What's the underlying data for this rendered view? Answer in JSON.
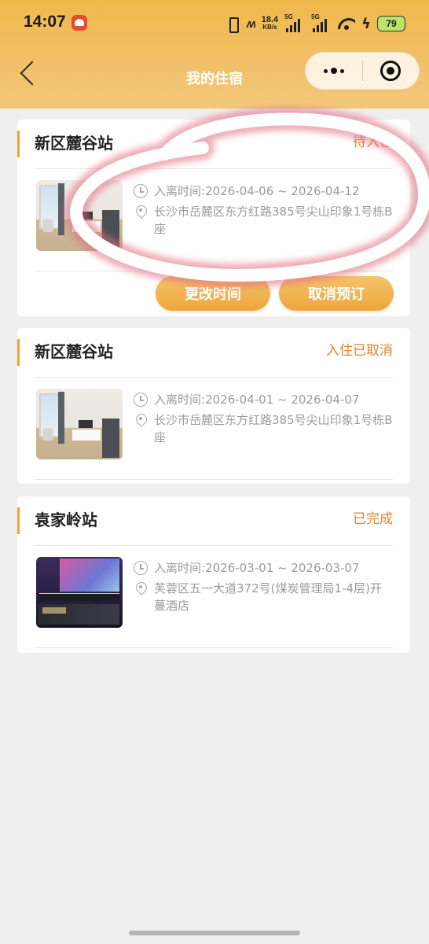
{
  "status_bar": {
    "time": "14:07",
    "network_speed": "18.4",
    "network_unit": "KB/s",
    "signal1_label": "5G",
    "signal2_label": "5G",
    "battery": "79"
  },
  "nav": {
    "title": "我的住宿"
  },
  "labels": {
    "time_prefix": "入离时间:"
  },
  "bookings": [
    {
      "station": "新区麓谷站",
      "status": "待入住",
      "dates": "2026-04-06 ~ 2026-04-12",
      "address": "长沙市岳麓区东方红路385号尖山印象1号栋B座",
      "actions": [
        "更改时间",
        "取消预订"
      ]
    },
    {
      "station": "新区麓谷站",
      "status": "入住已取消",
      "dates": "2026-04-01 ~ 2026-04-07",
      "address": "长沙市岳麓区东方红路385号尖山印象1号栋B座"
    },
    {
      "station": "袁家岭站",
      "status": "已完成",
      "dates": "2026-03-01 ~ 2026-03-07",
      "address": "芙蓉区五一大道372号(煤炭管理局1-4层)开蔓酒店"
    }
  ],
  "colors": {
    "header": "#f0b94a",
    "status_text": "#e3822f",
    "button": "#eda63c",
    "annotation": "#d8455a"
  }
}
